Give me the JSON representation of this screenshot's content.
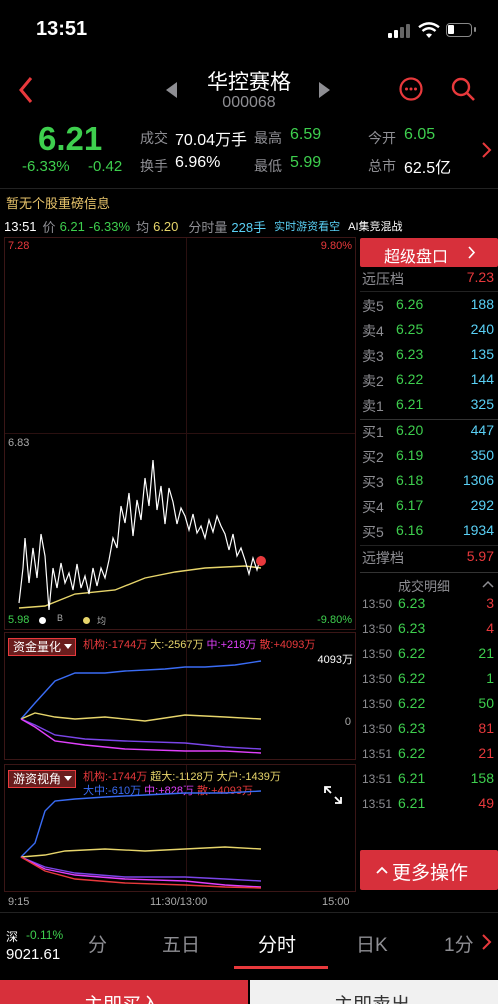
{
  "status": {
    "time": "13:51"
  },
  "header": {
    "name": "华控赛格",
    "code": "000068"
  },
  "quote": {
    "price": "6.21",
    "change_pct": "-6.33%",
    "change": "-0.42",
    "volume_label": "成交",
    "volume": "70.04万手",
    "high_label": "最高",
    "high": "6.59",
    "open_label": "今开",
    "open": "6.05",
    "turnover_label": "换手",
    "turnover": "6.96%",
    "low_label": "最低",
    "low": "5.99",
    "mcap_label": "总市",
    "mcap": "62.5亿"
  },
  "notice": "暂无个股重磅信息",
  "infobar": {
    "time": "13:51",
    "price_label": "价",
    "price": "6.21",
    "pct": "-6.33%",
    "avg_label": "均",
    "avg": "6.20",
    "vol_label": "分时量",
    "vol": "228手",
    "live": "实时游资看空",
    "ai": "AI集竞混战"
  },
  "chart": {
    "top_left": "7.28",
    "top_right": "9.80%",
    "mid_left": "6.83",
    "bottom_left": "5.98",
    "bottom_right": "-9.80%",
    "markers": [
      "B",
      "均"
    ]
  },
  "panel1": {
    "tag": "资金量化",
    "jigou": "机构:-1744万",
    "da": "大:-2567万",
    "zhong": "中:+218万",
    "san": "散:+4093万",
    "right_value": "4093万",
    "zero": "0"
  },
  "panel2": {
    "tag": "游资视角",
    "jigou": "机构:-1744万",
    "chaoda": "超大:-1128万",
    "dahu": "大户:-1439万",
    "dazhong": "大中:-610万",
    "zhong": "中:+828万",
    "san": "散:+4093万"
  },
  "time_axis": {
    "start": "9:15",
    "mid": "11:30/13:00",
    "end": "15:00"
  },
  "orderbook": {
    "title": "超级盘口",
    "pressure_label": "远压档",
    "pressure": "7.23",
    "asks": [
      {
        "label": "卖5",
        "price": "6.26",
        "vol": "188"
      },
      {
        "label": "卖4",
        "price": "6.25",
        "vol": "240"
      },
      {
        "label": "卖3",
        "price": "6.23",
        "vol": "135"
      },
      {
        "label": "卖2",
        "price": "6.22",
        "vol": "144"
      },
      {
        "label": "卖1",
        "price": "6.21",
        "vol": "325"
      }
    ],
    "bids": [
      {
        "label": "买1",
        "price": "6.20",
        "vol": "447"
      },
      {
        "label": "买2",
        "price": "6.19",
        "vol": "350"
      },
      {
        "label": "买3",
        "price": "6.18",
        "vol": "1306"
      },
      {
        "label": "买4",
        "price": "6.17",
        "vol": "292"
      },
      {
        "label": "买5",
        "price": "6.16",
        "vol": "1934"
      }
    ],
    "support_label": "远撑档",
    "support": "5.97"
  },
  "trades": {
    "title": "成交明细",
    "rows": [
      {
        "time": "13:50",
        "price": "6.23",
        "vol": "3",
        "color": "#e8393c"
      },
      {
        "time": "13:50",
        "price": "6.23",
        "vol": "4",
        "color": "#e8393c"
      },
      {
        "time": "13:50",
        "price": "6.22",
        "vol": "21",
        "color": "#3ecf4e"
      },
      {
        "time": "13:50",
        "price": "6.22",
        "vol": "1",
        "color": "#3ecf4e"
      },
      {
        "time": "13:50",
        "price": "6.22",
        "vol": "50",
        "color": "#3ecf4e"
      },
      {
        "time": "13:50",
        "price": "6.23",
        "vol": "81",
        "color": "#e8393c"
      },
      {
        "time": "13:51",
        "price": "6.22",
        "vol": "21",
        "color": "#e8393c"
      },
      {
        "time": "13:51",
        "price": "6.21",
        "vol": "158",
        "color": "#3ecf4e"
      },
      {
        "time": "13:51",
        "price": "6.21",
        "vol": "49",
        "color": "#e8393c"
      }
    ]
  },
  "more_ops": "更多操作",
  "bottom": {
    "index_label": "深",
    "index_change": "-0.11%",
    "index_value": "9021.61",
    "tabs": [
      "分",
      "五日",
      "分时",
      "日K",
      "1分"
    ]
  },
  "actions": {
    "buy": "主即买入",
    "sell": "主即卖出"
  }
}
